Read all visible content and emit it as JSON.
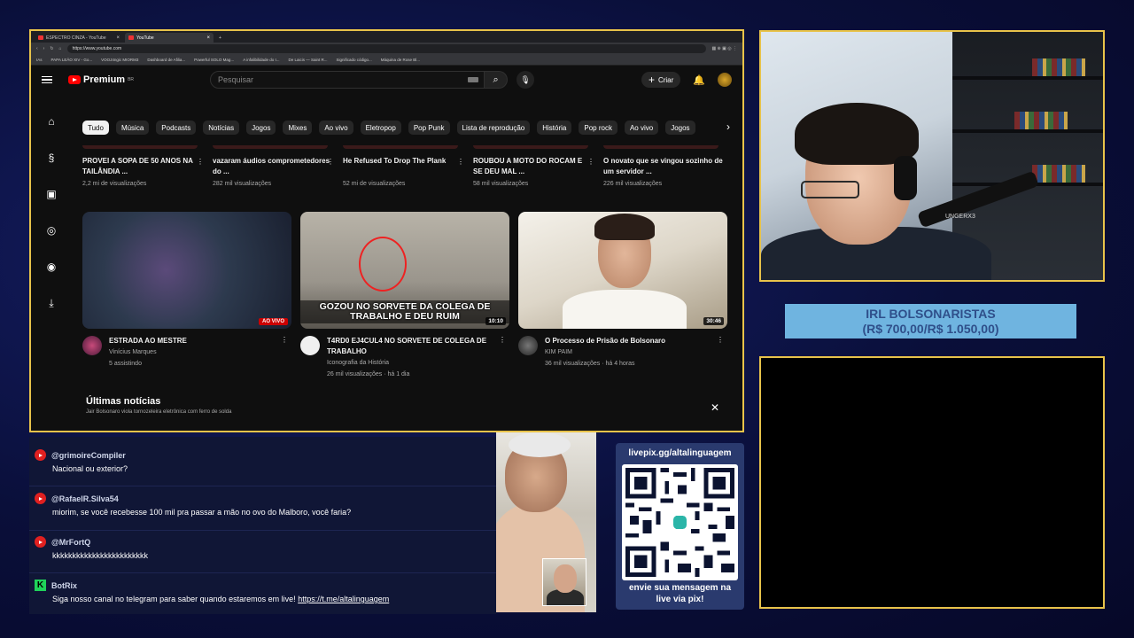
{
  "browser": {
    "tabs": [
      {
        "label": "ESPECTRO CINZA - YouTube",
        "active": false
      },
      {
        "label": "YouTube",
        "active": true
      }
    ],
    "url": "https://www.youtube.com",
    "bookmarks": [
      "IAs",
      "PAPA LEÃO XIV - Go...",
      "VOOJ4ngic MIORM3",
      "Dashboard de Afilia...",
      "Powerful SOLO Mag...",
      "A infalibilidade do I...",
      "De Laicis — Saint R...",
      "Significado código...",
      "Máquina de Rose Bl..."
    ]
  },
  "youtube": {
    "logo": "Premium",
    "logo_sup": "BR",
    "search_placeholder": "Pesquisar",
    "create_label": "Criar",
    "chips": [
      "Tudo",
      "Música",
      "Podcasts",
      "Notícias",
      "Jogos",
      "Mixes",
      "Ao vivo",
      "Eletropop",
      "Pop Punk",
      "Lista de reprodução",
      "História",
      "Pop rock",
      "Ao vivo",
      "Jogos"
    ],
    "row1": [
      {
        "title": "PROVEI A SOPA DE 50 ANOS NA TAILÂNDIA ...",
        "meta": "2,2 mi de visualizações"
      },
      {
        "title": "vazaram áudios comprometedores do ...",
        "meta": "282 mil visualizações"
      },
      {
        "title": "He Refused To Drop The Plank",
        "meta": "52 mi de visualizações"
      },
      {
        "title": "ROUBOU A MOTO DO ROCAM E SE DEU MAL ...",
        "meta": "58 mil visualizações"
      },
      {
        "title": "O novato que se vingou sozinho de um servidor ...",
        "meta": "226 mil visualizações"
      }
    ],
    "row2": [
      {
        "title": "ESTRADA AO MESTRE",
        "channel": "Vinícius Marques",
        "meta": "5 assistindo",
        "badge": "AO VIVO"
      },
      {
        "title": "T4RD0 EJ4CUL4 NO SORVETE DE COLEGA DE TRABALHO",
        "channel": "Iconografia da História",
        "meta": "26 mil visualizações · há 1 dia",
        "duration": "10:10",
        "caption": "GOZOU NO SORVETE DA COLEGA DE TRABALHO E DEU RUIM"
      },
      {
        "title": "O Processo de Prisão de Bolsonaro",
        "channel": "KIM PAIM",
        "meta": "36 mil visualizações · há 4 horas",
        "duration": "30:46"
      }
    ],
    "news_title": "Últimas notícias",
    "news_sub": "Jair Bolsonaro viola tornozeleira eletrônica com ferro de solda"
  },
  "chat": [
    {
      "user": "@grimoireCompiler",
      "text": "Nacional ou exterior?",
      "source": "youtube"
    },
    {
      "user": "@RafaelR.Silva54",
      "text": "miorim, se você recebesse 100 mil pra passar a mão no ovo do Malboro, você faria?",
      "source": "youtube"
    },
    {
      "user": "@MrFortQ",
      "text": "kkkkkkkkkkkkkkkkkkkkkkkk",
      "source": "youtube"
    },
    {
      "user": "BotRix",
      "text": "Siga nosso canal no telegram para saber quando estaremos em live!",
      "link": "https://t.me/altalinguagem",
      "source": "kick"
    }
  ],
  "pix": {
    "url": "livepix.gg/altalinguagem",
    "message_line1": "envie sua mensagem na",
    "message_line2": "live via pix!"
  },
  "goal": {
    "line1": "IRL BOLSONARISTAS",
    "line2": "(R$ 700,00/R$ 1.050,00)",
    "progress": 0.667
  },
  "camera": {
    "headset_text": "UNGERX3"
  },
  "colors": {
    "frame": "#e8c34a",
    "yt_red": "#ff0000",
    "chat_bg": "#101636",
    "goal_bar": "#6fb4e0"
  }
}
